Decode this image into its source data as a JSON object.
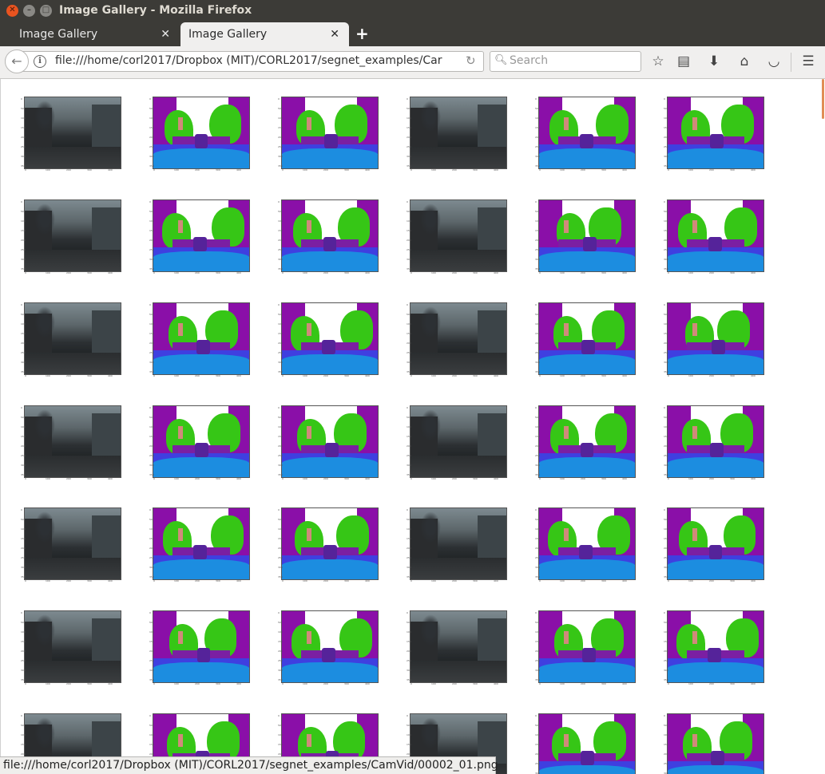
{
  "window": {
    "title": "Image Gallery - Mozilla Firefox"
  },
  "tabs": [
    {
      "label": "Image Gallery",
      "active": false
    },
    {
      "label": "Image Gallery",
      "active": true
    }
  ],
  "newtab_label": "+",
  "navbar": {
    "url": "file:///home/corl2017/Dropbox (MIT)/CORL2017/segnet_examples/Car",
    "search_placeholder": "Search"
  },
  "toolbar_icons": [
    "star-icon",
    "reading-list-icon",
    "download-icon",
    "home-icon",
    "pocket-icon",
    "menu-icon"
  ],
  "gallery": {
    "columns": [
      "input",
      "segmentation-a",
      "segmentation-b",
      "input",
      "segmentation-c",
      "segmentation-d"
    ],
    "rows": 7,
    "y_ticks": [
      "0",
      "50",
      "100",
      "150",
      "200",
      "250",
      "300",
      "350"
    ],
    "x_ticks": [
      "0",
      "100",
      "200",
      "300",
      "400"
    ]
  },
  "status": {
    "text": "file:///home/corl2017/Dropbox (MIT)/CORL2017/segnet_examples/CamVid/00002_01.png"
  },
  "colors": {
    "titlebar": "#3c3b37",
    "close_button": "#e95420",
    "seg_sky": "#ffffff",
    "seg_building": "#8a0fa8",
    "seg_tree": "#36c616",
    "seg_road": "#1c8de0",
    "seg_sidewalk": "#3f3fe0",
    "seg_car": "#55239a"
  }
}
